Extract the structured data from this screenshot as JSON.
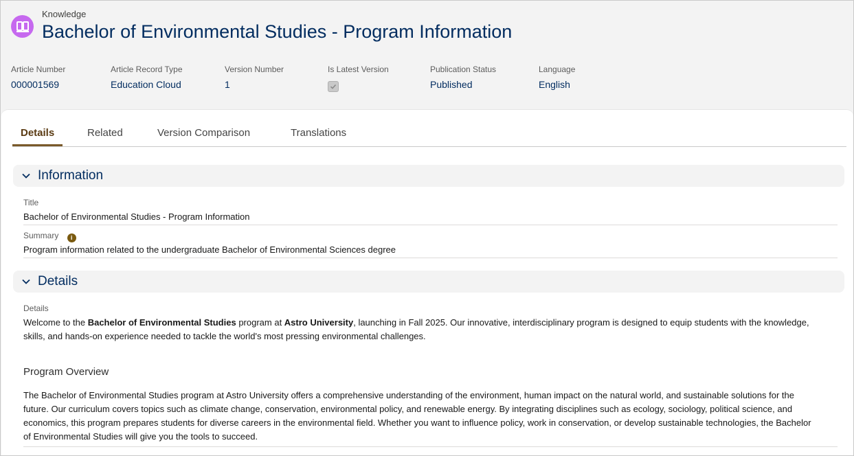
{
  "header": {
    "object_label": "Knowledge",
    "title": "Bachelor of Environmental Studies - Program Information",
    "fields": [
      {
        "label": "Article Number",
        "value": "000001569"
      },
      {
        "label": "Article Record Type",
        "value": "Education Cloud"
      },
      {
        "label": "Version Number",
        "value": "1"
      },
      {
        "label": "Is Latest Version",
        "checked": true
      },
      {
        "label": "Publication Status",
        "value": "Published"
      },
      {
        "label": "Language",
        "value": "English"
      }
    ]
  },
  "tabs": [
    "Details",
    "Related",
    "Version Comparison",
    "Translations"
  ],
  "active_tab": "Details",
  "info_section": {
    "title": "Information",
    "title_label": "Title",
    "title_value": "Bachelor of Environmental Studies - Program Information",
    "summary_label": "Summary",
    "summary_value": "Program information related to the undergraduate Bachelor of Environmental Sciences degree"
  },
  "details_section": {
    "title": "Details",
    "field_label": "Details",
    "intro_1": "Welcome to the ",
    "intro_bold_1": "Bachelor of Environmental Studies",
    "intro_2": " program at ",
    "intro_bold_2": "Astro University",
    "intro_3": ", launching in Fall 2025. Our innovative, interdisciplinary program is designed to equip students with the knowledge, skills, and hands-on experience needed to tackle the world's most pressing environmental challenges.",
    "overview_heading": "Program Overview",
    "overview_text": "The Bachelor of Environmental Studies program at Astro University offers a comprehensive understanding of the environment, human impact on the natural world, and sustainable solutions for the future. Our curriculum covers topics such as climate change, conservation, environmental policy, and renewable energy. By integrating disciplines such as ecology, sociology, political science, and economics, this program prepares students for diverse careers in the environmental field. Whether you want to influence policy, work in conservation, or develop sustainable technologies, the Bachelor of Environmental Studies will give you the tools to succeed."
  },
  "colors": {
    "object_icon": "#c669ef",
    "title_text": "#032d60",
    "active_tab": "#7a5a2a"
  },
  "icons": [
    "book-icon",
    "checkmark-icon",
    "chevron-down-icon",
    "info-icon"
  ]
}
